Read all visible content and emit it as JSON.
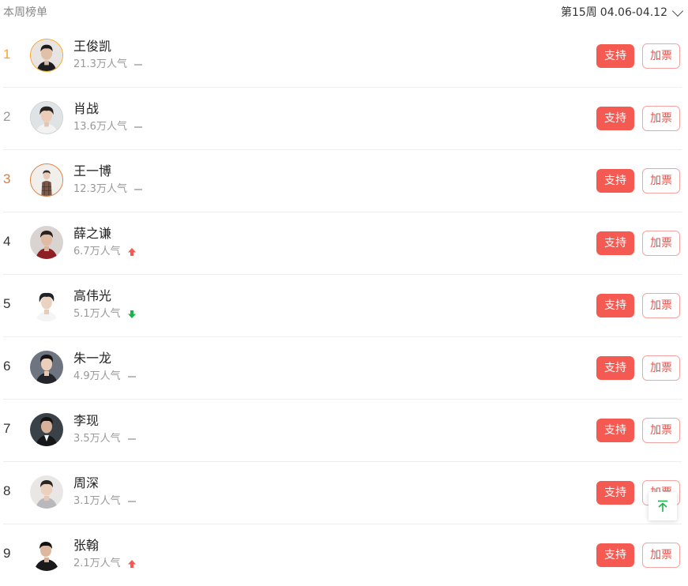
{
  "header": {
    "title": "本周榜单",
    "week_label": "第15周",
    "week_range": "04.06-04.12"
  },
  "colors": {
    "accent_red": "#f45a52",
    "rank1_gold": "#f5a623",
    "rank2_gray": "#999999",
    "rank3_orange": "#e07a3a",
    "trend_up": "#f45a52",
    "trend_down": "#1bb34a"
  },
  "ranking": [
    {
      "rank": "1",
      "name": "王俊凯",
      "popularity": "21.3万人气",
      "trend": "flat",
      "support_label": "支持",
      "vote_label": "加票"
    },
    {
      "rank": "2",
      "name": "肖战",
      "popularity": "13.6万人气",
      "trend": "flat",
      "support_label": "支持",
      "vote_label": "加票"
    },
    {
      "rank": "3",
      "name": "王一博",
      "popularity": "12.3万人气",
      "trend": "flat",
      "support_label": "支持",
      "vote_label": "加票"
    },
    {
      "rank": "4",
      "name": "薛之谦",
      "popularity": "6.7万人气",
      "trend": "up",
      "support_label": "支持",
      "vote_label": "加票"
    },
    {
      "rank": "5",
      "name": "高伟光",
      "popularity": "5.1万人气",
      "trend": "down",
      "support_label": "支持",
      "vote_label": "加票"
    },
    {
      "rank": "6",
      "name": "朱一龙",
      "popularity": "4.9万人气",
      "trend": "flat",
      "support_label": "支持",
      "vote_label": "加票"
    },
    {
      "rank": "7",
      "name": "李现",
      "popularity": "3.5万人气",
      "trend": "flat",
      "support_label": "支持",
      "vote_label": "加票"
    },
    {
      "rank": "8",
      "name": "周深",
      "popularity": "3.1万人气",
      "trend": "flat",
      "support_label": "支持",
      "vote_label": "加票"
    },
    {
      "rank": "9",
      "name": "张翰",
      "popularity": "2.1万人气",
      "trend": "up",
      "support_label": "支持",
      "vote_label": "加票"
    }
  ],
  "icons": {
    "week_dropdown": "chevron-down-icon",
    "back_to_top": "arrow-up-icon",
    "trend_up": "arrow-up-icon",
    "trend_down": "arrow-down-icon",
    "trend_flat": "dash-icon"
  }
}
